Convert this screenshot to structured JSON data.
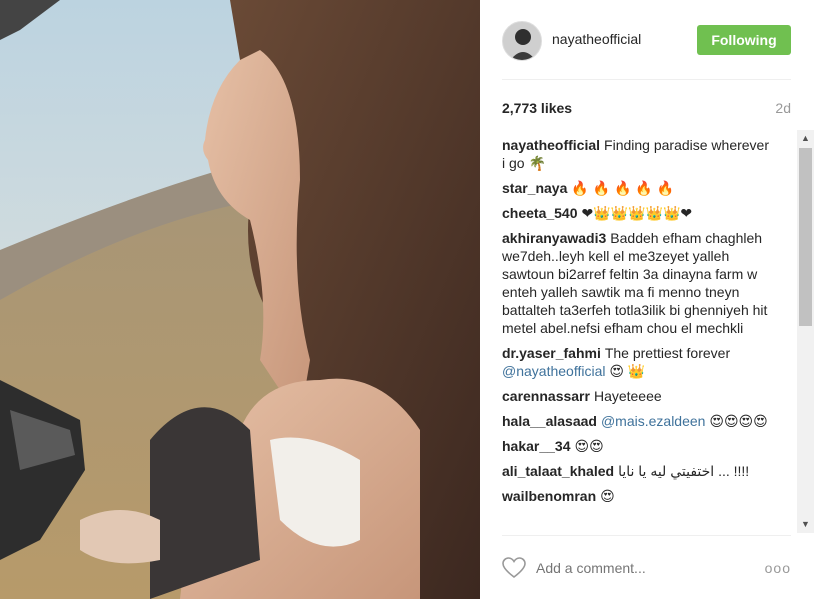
{
  "post": {
    "photo_icon": "photo-image"
  },
  "header": {
    "username": "nayatheofficial",
    "follow_label": "Following",
    "follow_color": "#70c050"
  },
  "stats": {
    "likes": "2,773 likes",
    "age": "2d"
  },
  "comments": [
    {
      "user": "nayatheofficial",
      "text": "Finding paradise wherever i go 🌴"
    },
    {
      "user": "star_naya",
      "text": "🔥 🔥 🔥 🔥 🔥"
    },
    {
      "user": "cheeta_540",
      "text": "❤👑👑👑👑👑❤"
    },
    {
      "user": "akhiranyawadi3",
      "text": "Baddeh efham chaghleh we7deh..leyh kell el me3zeyet yalleh sawtoun bi2arref feltin 3a dinayna farm w enteh yalleh sawtik ma fi menno tneyn battalteh ta3erfeh totla3ilik bi ghenniyeh hit metel abel.nefsi efham chou el mechkli"
    },
    {
      "user": "dr.yaser_fahmi",
      "text": "The prettiest forever",
      "mention": "@nayatheofficial",
      "after": " 😍 👑"
    },
    {
      "user": "carennassarr",
      "text": "Hayeteeee"
    },
    {
      "user": "hala__alasaad",
      "text": "",
      "mention": "@mais.ezaldeen",
      "after": " 😍😍😍😍"
    },
    {
      "user": "hakar__34",
      "text": "😍😍"
    },
    {
      "user": "ali_talaat_khaled",
      "text": "اختفيتي ليه يا نايا ... !!!!"
    },
    {
      "user": "wailbenomran",
      "text": "😍"
    }
  ],
  "footer": {
    "add_comment_placeholder": "Add a comment...",
    "more_label": "ooo"
  }
}
